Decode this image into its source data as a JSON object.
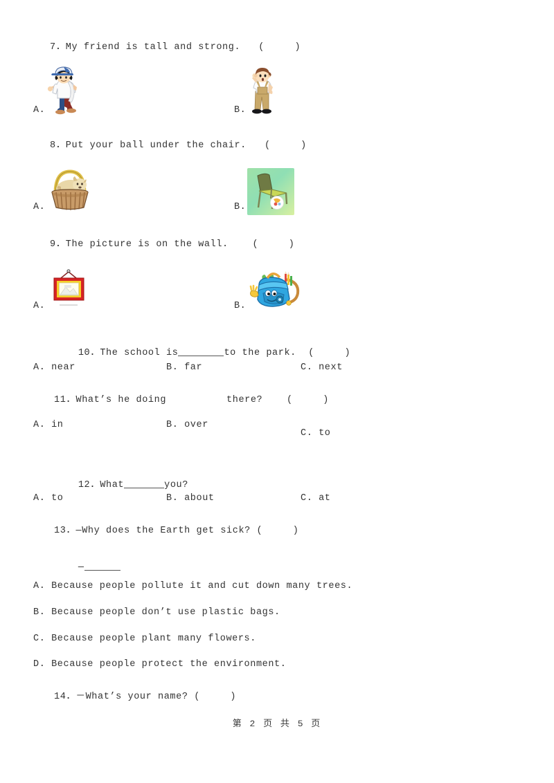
{
  "document": {
    "type": "english-exam-worksheet",
    "footer": "第 2 页 共 5 页"
  },
  "questions": [
    {
      "id": "q7",
      "text": "7．My friend is tall and strong.   (     )",
      "options": [
        {
          "label": "A.",
          "image": "boy-with-blue-cap-icon"
        },
        {
          "label": "B.",
          "image": "boy-with-tan-overalls-icon"
        }
      ]
    },
    {
      "id": "q8",
      "text": "8．Put your ball under the chair.   (     )",
      "options": [
        {
          "label": "A.",
          "image": "puppy-in-basket-icon"
        },
        {
          "label": "B.",
          "image": "chair-with-ball-icon"
        }
      ]
    },
    {
      "id": "q9",
      "text": "9．The picture is on the wall.    (     )",
      "options": [
        {
          "label": "A.",
          "image": "framed-picture-icon"
        },
        {
          "label": "B.",
          "image": "cartoon-backpack-icon"
        }
      ]
    },
    {
      "id": "q10",
      "text_before": "10．The school is",
      "text_after": "to the park.  (     )",
      "options": [
        {
          "label": "A. near"
        },
        {
          "label": "B. far"
        },
        {
          "label": "C. next"
        }
      ]
    },
    {
      "id": "q11",
      "text": "11．What’s he doing          there?    (     )",
      "options": [
        {
          "label": "A. in"
        },
        {
          "label": "B. over"
        },
        {
          "label": "C. to"
        }
      ]
    },
    {
      "id": "q12",
      "text_before": "12．What",
      "text_after": "you?",
      "options": [
        {
          "label": "A. to"
        },
        {
          "label": "B. about"
        },
        {
          "label": "C. at"
        }
      ]
    },
    {
      "id": "q13",
      "text": "13．—Why does the Earth get sick? (     )",
      "answer_line": "—",
      "options": [
        {
          "label": "A. Because people pollute it and cut down many trees."
        },
        {
          "label": "B. Because people don’t use plastic bags."
        },
        {
          "label": "C. Because people plant many flowers."
        },
        {
          "label": "D. Because people protect the environment."
        }
      ]
    },
    {
      "id": "q14",
      "text": "14．－What’s your name? (     )"
    }
  ],
  "colors": {
    "text": "#333333",
    "page_background": "#ffffff",
    "blank_rule": "#555555"
  }
}
